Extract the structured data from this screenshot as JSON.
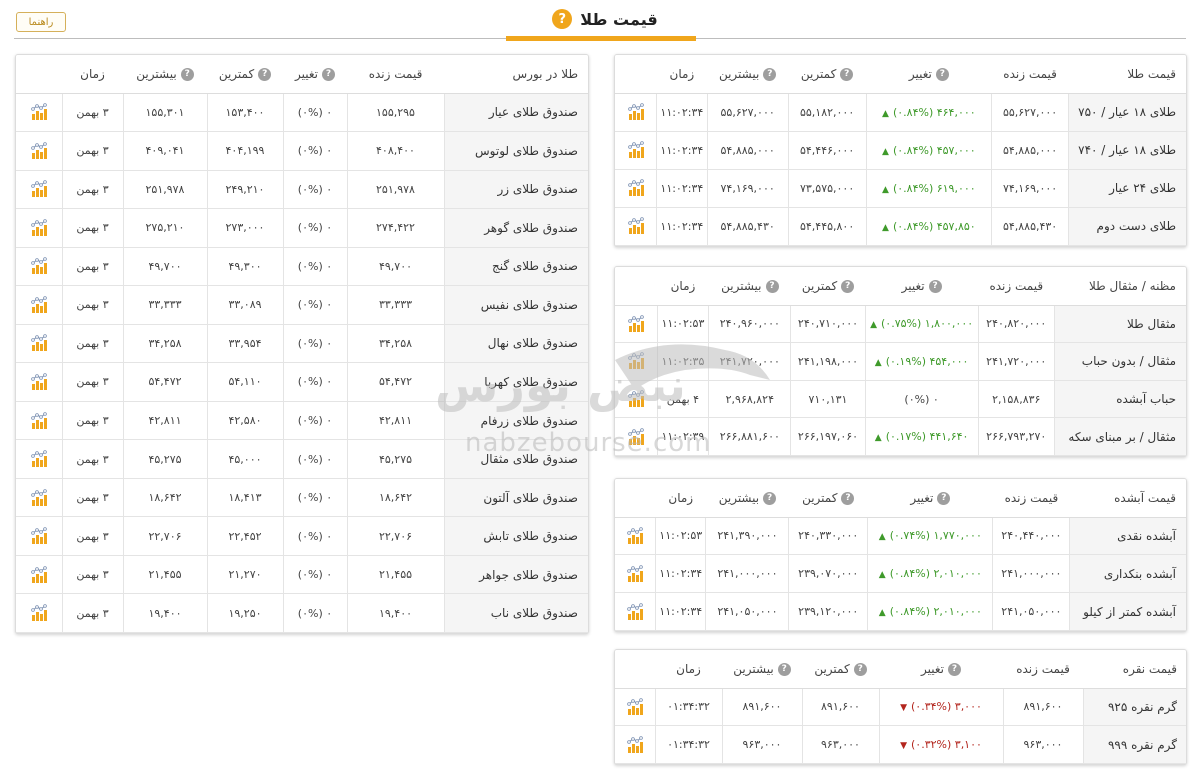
{
  "header": {
    "title": "قیمت طلا",
    "help_label": "راهنما"
  },
  "colors": {
    "accent": "#f0a61c",
    "positive": "#3f9a2b",
    "negative": "#b3261e"
  },
  "bourse": {
    "headers": [
      "طلا در بورس",
      "قیمت زنده",
      "تغییر",
      "کمترین",
      "بیشترین",
      "زمان"
    ],
    "rows": [
      {
        "name": "صندوق طلای عیار",
        "live": "۱۵۵,۲۹۵",
        "change": "۰ (۰%)",
        "low": "۱۵۳,۴۰۰",
        "high": "۱۵۵,۳۰۱",
        "time": "۳ بهمن"
      },
      {
        "name": "صندوق طلای لوتوس",
        "live": "۴۰۸,۴۰۰",
        "change": "۰ (۰%)",
        "low": "۴۰۴,۱۹۹",
        "high": "۴۰۹,۰۴۱",
        "time": "۳ بهمن"
      },
      {
        "name": "صندوق طلای زر",
        "live": "۲۵۱,۹۷۸",
        "change": "۰ (۰%)",
        "low": "۲۴۹,۲۱۰",
        "high": "۲۵۱,۹۷۸",
        "time": "۳ بهمن"
      },
      {
        "name": "صندوق طلای گوهر",
        "live": "۲۷۴,۴۲۲",
        "change": "۰ (۰%)",
        "low": "۲۷۳,۰۰۰",
        "high": "۲۷۵,۲۱۰",
        "time": "۳ بهمن"
      },
      {
        "name": "صندوق طلای گنج",
        "live": "۴۹,۷۰۰",
        "change": "۰ (۰%)",
        "low": "۴۹,۳۰۰",
        "high": "۴۹,۷۰۰",
        "time": "۳ بهمن"
      },
      {
        "name": "صندوق طلای نفیس",
        "live": "۳۳,۳۳۳",
        "change": "۰ (۰%)",
        "low": "۳۳,۰۸۹",
        "high": "۳۳,۳۳۳",
        "time": "۳ بهمن"
      },
      {
        "name": "صندوق طلای نهال",
        "live": "۳۴,۲۵۸",
        "change": "۰ (۰%)",
        "low": "۳۳,۹۵۴",
        "high": "۳۴,۲۵۸",
        "time": "۳ بهمن"
      },
      {
        "name": "صندوق طلای کهربا",
        "live": "۵۴,۴۷۲",
        "change": "۰ (۰%)",
        "low": "۵۴,۱۱۰",
        "high": "۵۴,۴۷۲",
        "time": "۳ بهمن"
      },
      {
        "name": "صندوق طلای زرفام",
        "live": "۴۲,۸۱۱",
        "change": "۰ (۰%)",
        "low": "۴۲,۵۸۰",
        "high": "۴۲,۸۱۱",
        "time": "۳ بهمن"
      },
      {
        "name": "صندوق طلای مثقال",
        "live": "۴۵,۲۷۵",
        "change": "۰ (۰%)",
        "low": "۴۵,۰۰۰",
        "high": "۴۵,۲۷۵",
        "time": "۳ بهمن"
      },
      {
        "name": "صندوق طلای آلتون",
        "live": "۱۸,۶۴۲",
        "change": "۰ (۰%)",
        "low": "۱۸,۴۱۳",
        "high": "۱۸,۶۴۲",
        "time": "۳ بهمن"
      },
      {
        "name": "صندوق طلای تابش",
        "live": "۲۲,۷۰۶",
        "change": "۰ (۰%)",
        "low": "۲۲,۴۵۲",
        "high": "۲۲,۷۰۶",
        "time": "۳ بهمن"
      },
      {
        "name": "صندوق طلای جواهر",
        "live": "۲۱,۴۵۵",
        "change": "۰ (۰%)",
        "low": "۲۱,۲۷۰",
        "high": "۲۱,۴۵۵",
        "time": "۳ بهمن"
      },
      {
        "name": "صندوق طلای ناب",
        "live": "۱۹,۴۰۰",
        "change": "۰ (۰%)",
        "low": "۱۹,۲۵۰",
        "high": "۱۹,۴۰۰",
        "time": "۳ بهمن"
      }
    ]
  },
  "gold": {
    "headers": [
      "قیمت طلا",
      "قیمت زنده",
      "تغییر",
      "کمترین",
      "بیشترین",
      "زمان"
    ],
    "rows": [
      {
        "name": "طلای ۱۸ عیار / ۷۵۰",
        "live": "۵۵,۶۲۷,۰۰۰",
        "change": "۴۶۴,۰۰۰ (۰.۸۴%)",
        "dir": "up",
        "low": "۵۵,۱۸۲,۰۰۰",
        "high": "۵۵,۶۲۷,۰۰۰",
        "time": "۱۱:۰۲:۳۴"
      },
      {
        "name": "طلای ۱۸ عیار / ۷۴۰",
        "live": "۵۴,۸۸۵,۰۰۰",
        "change": "۴۵۷,۰۰۰ (۰.۸۴%)",
        "dir": "up",
        "low": "۵۴,۴۴۶,۰۰۰",
        "high": "۵۴,۸۸۵,۰۰۰",
        "time": "۱۱:۰۲:۳۴"
      },
      {
        "name": "طلای ۲۴ عیار",
        "live": "۷۴,۱۶۹,۰۰۰",
        "change": "۶۱۹,۰۰۰ (۰.۸۴%)",
        "dir": "up",
        "low": "۷۳,۵۷۵,۰۰۰",
        "high": "۷۴,۱۶۹,۰۰۰",
        "time": "۱۱:۰۲:۳۴"
      },
      {
        "name": "طلای دست دوم",
        "live": "۵۴,۸۸۵,۴۳۰",
        "change": "۴۵۷,۸۵۰ (۰.۸۴%)",
        "dir": "up",
        "low": "۵۴,۴۴۵,۸۰۰",
        "high": "۵۴,۸۸۵,۴۳۰",
        "time": "۱۱:۰۲:۳۴"
      }
    ]
  },
  "mesghal": {
    "headers": [
      "مظنه / مثقال طلا",
      "قیمت زنده",
      "تغییر",
      "کمترین",
      "بیشترین",
      "زمان"
    ],
    "rows": [
      {
        "name": "مثقال طلا",
        "live": "۲۴۰,۸۲۰,۰۰۰",
        "change": "۱,۸۰۰,۰۰۰ (۰.۷۵%)",
        "dir": "up",
        "low": "۲۴۰,۷۱۰,۰۰۰",
        "high": "۲۴۰,۹۶۰,۰۰۰",
        "time": "۱۱:۰۲:۵۳"
      },
      {
        "name": "مثقال / بدون حباب",
        "live": "۲۴۱,۷۲۰,۰۰۰",
        "change": "۴۵۴,۰۰۰ (۰.۱۹%)",
        "dir": "up",
        "low": "۲۴۱,۱۹۸,۰۰۰",
        "high": "۲۴۱,۷۲۰,۰۰۰",
        "time": "۱۱:۰۲:۳۵"
      },
      {
        "name": "حباب آبشده",
        "live": "۲,۱۵۸,۸۳۶",
        "change": "۰ (۰%)",
        "dir": "none",
        "low": "۷۱۰,۱۳۱",
        "high": "۲,۹۶۸,۸۲۴",
        "time": "۴ بهمن"
      },
      {
        "name": "مثقال / بر مبنای سکه",
        "live": "۲۶۶,۷۹۳,۲۷۰",
        "change": "۴۴۱,۶۴۰ (۰.۱۷%)",
        "dir": "up",
        "low": "۲۶۶,۱۹۷,۰۶۰",
        "high": "۲۶۶,۸۸۱,۶۰۰",
        "time": "۱۱:۰۲:۳۹"
      }
    ]
  },
  "abshodeh": {
    "headers": [
      "قیمت آبشده",
      "قیمت زنده",
      "تغییر",
      "کمترین",
      "بیشترین",
      "زمان"
    ],
    "rows": [
      {
        "name": "آبشده نقدی",
        "live": "۲۴۰,۴۴۰,۰۰۰",
        "change": "۱,۷۷۰,۰۰۰ (۰.۷۴%)",
        "dir": "up",
        "low": "۲۴۰,۳۳۰,۰۰۰",
        "high": "۲۴۱,۳۹۰,۰۰۰",
        "time": "۱۱:۰۲:۵۳"
      },
      {
        "name": "آبشده بنکداری",
        "live": "۲۴۱,۰۰۰,۰۰۰",
        "change": "۲,۰۱۰,۰۰۰ (۰.۸۴%)",
        "dir": "up",
        "low": "۲۳۹,۰۷۰,۰۰۰",
        "high": "۲۴۱,۰۰۰,۰۰۰",
        "time": "۱۱:۰۲:۳۴"
      },
      {
        "name": "آبشده کمتر از کیلو",
        "live": "۲۴۱,۰۵۰,۰۰۰",
        "change": "۲,۰۱۰,۰۰۰ (۰.۸۴%)",
        "dir": "up",
        "low": "۲۳۹,۱۲۰,۰۰۰",
        "high": "۲۴۱,۰۵۰,۰۰۰",
        "time": "۱۱:۰۲:۳۴"
      }
    ]
  },
  "silver": {
    "headers": [
      "قیمت نقره",
      "قیمت زنده",
      "تغییر",
      "کمترین",
      "بیشترین",
      "زمان"
    ],
    "rows": [
      {
        "name": "گرم نقره ۹۲۵",
        "live": "۸۹۱,۶۰۰",
        "change": "۳,۰۰۰ (۰.۳۴%)",
        "dir": "down",
        "low": "۸۹۱,۶۰۰",
        "high": "۸۹۱,۶۰۰",
        "time": "۰۱:۳۴:۳۲"
      },
      {
        "name": "گرم نقره ۹۹۹",
        "live": "۹۶۳,۰۰۰",
        "change": "۳,۱۰۰ (۰.۳۲%)",
        "dir": "down",
        "low": "۹۶۳,۰۰۰",
        "high": "۹۶۳,۰۰۰",
        "time": "۰۱:۳۴:۳۲"
      }
    ]
  },
  "watermark": {
    "fa": "نبض بورس",
    "en": "nabzebourse.com"
  },
  "icons": {
    "row_chart": "chart-icon",
    "help": "question-icon",
    "up": "arrow-up-icon",
    "down": "arrow-down-icon"
  }
}
